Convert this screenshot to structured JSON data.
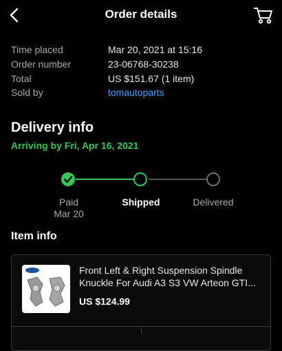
{
  "header": {
    "title": "Order details",
    "back_icon": "back-arrow-icon",
    "cart_icon": "cart-icon"
  },
  "details": {
    "time_placed_label": "Time placed",
    "time_placed": "Mar 20, 2021 at 15:16",
    "order_number_label": "Order number",
    "order_number": "23-06768-30238",
    "total_label": "Total",
    "total": "US $151.67 (1 item)",
    "sold_by_label": "Sold by",
    "sold_by": "tomautoparts"
  },
  "delivery": {
    "heading": "Delivery info",
    "arriving": "Arriving by Fri, Apr 16, 2021",
    "steps": [
      {
        "label": "Paid",
        "sub": "Mar 20",
        "state": "done"
      },
      {
        "label": "Shipped",
        "sub": "",
        "state": "active"
      },
      {
        "label": "Delivered",
        "sub": "",
        "state": "todo"
      }
    ]
  },
  "item_info": {
    "heading": "Item info",
    "title": "Front Left & Right Suspension Spindle Knuckle For Audi A3 S3 VW Arteon GTI...",
    "price": "US $124.99"
  },
  "colors": {
    "accent_green": "#34c759",
    "link_blue": "#3aa5ff",
    "background": "#000000"
  }
}
